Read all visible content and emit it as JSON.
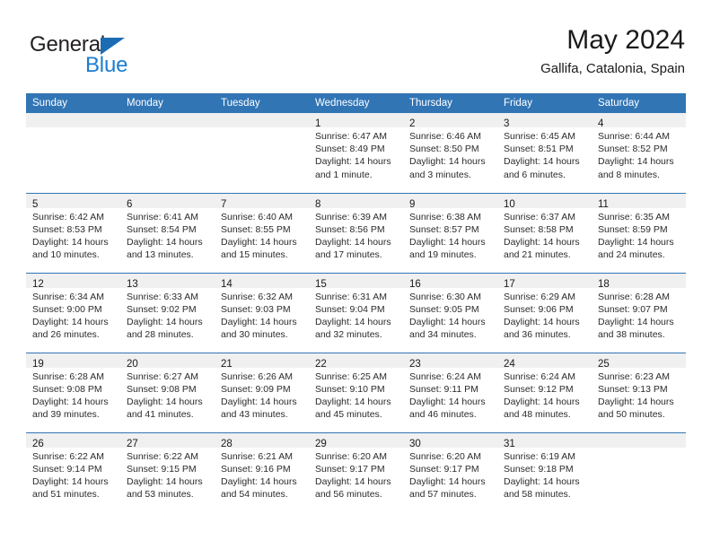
{
  "logo": {
    "word_top": "General",
    "word_bottom": "Blue",
    "triangle_color": "#1b6cb3",
    "blue_color": "#1b7dd1"
  },
  "header": {
    "title": "May 2024",
    "subtitle": "Gallifa, Catalonia, Spain",
    "header_bg": "#3175b5",
    "daynum_bg": "#f0f0f0"
  },
  "weekdays": [
    "Sunday",
    "Monday",
    "Tuesday",
    "Wednesday",
    "Thursday",
    "Friday",
    "Saturday"
  ],
  "labels": {
    "sunrise": "Sunrise:",
    "sunset": "Sunset:",
    "daylight": "Daylight:"
  },
  "weeks": [
    [
      {
        "blank": true
      },
      {
        "blank": true
      },
      {
        "blank": true
      },
      {
        "day": "1",
        "sunrise": "Sunrise: 6:47 AM",
        "sunset": "Sunset: 8:49 PM",
        "daylight_1": "Daylight: 14 hours",
        "daylight_2": "and 1 minute."
      },
      {
        "day": "2",
        "sunrise": "Sunrise: 6:46 AM",
        "sunset": "Sunset: 8:50 PM",
        "daylight_1": "Daylight: 14 hours",
        "daylight_2": "and 3 minutes."
      },
      {
        "day": "3",
        "sunrise": "Sunrise: 6:45 AM",
        "sunset": "Sunset: 8:51 PM",
        "daylight_1": "Daylight: 14 hours",
        "daylight_2": "and 6 minutes."
      },
      {
        "day": "4",
        "sunrise": "Sunrise: 6:44 AM",
        "sunset": "Sunset: 8:52 PM",
        "daylight_1": "Daylight: 14 hours",
        "daylight_2": "and 8 minutes."
      }
    ],
    [
      {
        "day": "5",
        "sunrise": "Sunrise: 6:42 AM",
        "sunset": "Sunset: 8:53 PM",
        "daylight_1": "Daylight: 14 hours",
        "daylight_2": "and 10 minutes."
      },
      {
        "day": "6",
        "sunrise": "Sunrise: 6:41 AM",
        "sunset": "Sunset: 8:54 PM",
        "daylight_1": "Daylight: 14 hours",
        "daylight_2": "and 13 minutes."
      },
      {
        "day": "7",
        "sunrise": "Sunrise: 6:40 AM",
        "sunset": "Sunset: 8:55 PM",
        "daylight_1": "Daylight: 14 hours",
        "daylight_2": "and 15 minutes."
      },
      {
        "day": "8",
        "sunrise": "Sunrise: 6:39 AM",
        "sunset": "Sunset: 8:56 PM",
        "daylight_1": "Daylight: 14 hours",
        "daylight_2": "and 17 minutes."
      },
      {
        "day": "9",
        "sunrise": "Sunrise: 6:38 AM",
        "sunset": "Sunset: 8:57 PM",
        "daylight_1": "Daylight: 14 hours",
        "daylight_2": "and 19 minutes."
      },
      {
        "day": "10",
        "sunrise": "Sunrise: 6:37 AM",
        "sunset": "Sunset: 8:58 PM",
        "daylight_1": "Daylight: 14 hours",
        "daylight_2": "and 21 minutes."
      },
      {
        "day": "11",
        "sunrise": "Sunrise: 6:35 AM",
        "sunset": "Sunset: 8:59 PM",
        "daylight_1": "Daylight: 14 hours",
        "daylight_2": "and 24 minutes."
      }
    ],
    [
      {
        "day": "12",
        "sunrise": "Sunrise: 6:34 AM",
        "sunset": "Sunset: 9:00 PM",
        "daylight_1": "Daylight: 14 hours",
        "daylight_2": "and 26 minutes."
      },
      {
        "day": "13",
        "sunrise": "Sunrise: 6:33 AM",
        "sunset": "Sunset: 9:02 PM",
        "daylight_1": "Daylight: 14 hours",
        "daylight_2": "and 28 minutes."
      },
      {
        "day": "14",
        "sunrise": "Sunrise: 6:32 AM",
        "sunset": "Sunset: 9:03 PM",
        "daylight_1": "Daylight: 14 hours",
        "daylight_2": "and 30 minutes."
      },
      {
        "day": "15",
        "sunrise": "Sunrise: 6:31 AM",
        "sunset": "Sunset: 9:04 PM",
        "daylight_1": "Daylight: 14 hours",
        "daylight_2": "and 32 minutes."
      },
      {
        "day": "16",
        "sunrise": "Sunrise: 6:30 AM",
        "sunset": "Sunset: 9:05 PM",
        "daylight_1": "Daylight: 14 hours",
        "daylight_2": "and 34 minutes."
      },
      {
        "day": "17",
        "sunrise": "Sunrise: 6:29 AM",
        "sunset": "Sunset: 9:06 PM",
        "daylight_1": "Daylight: 14 hours",
        "daylight_2": "and 36 minutes."
      },
      {
        "day": "18",
        "sunrise": "Sunrise: 6:28 AM",
        "sunset": "Sunset: 9:07 PM",
        "daylight_1": "Daylight: 14 hours",
        "daylight_2": "and 38 minutes."
      }
    ],
    [
      {
        "day": "19",
        "sunrise": "Sunrise: 6:28 AM",
        "sunset": "Sunset: 9:08 PM",
        "daylight_1": "Daylight: 14 hours",
        "daylight_2": "and 39 minutes."
      },
      {
        "day": "20",
        "sunrise": "Sunrise: 6:27 AM",
        "sunset": "Sunset: 9:08 PM",
        "daylight_1": "Daylight: 14 hours",
        "daylight_2": "and 41 minutes."
      },
      {
        "day": "21",
        "sunrise": "Sunrise: 6:26 AM",
        "sunset": "Sunset: 9:09 PM",
        "daylight_1": "Daylight: 14 hours",
        "daylight_2": "and 43 minutes."
      },
      {
        "day": "22",
        "sunrise": "Sunrise: 6:25 AM",
        "sunset": "Sunset: 9:10 PM",
        "daylight_1": "Daylight: 14 hours",
        "daylight_2": "and 45 minutes."
      },
      {
        "day": "23",
        "sunrise": "Sunrise: 6:24 AM",
        "sunset": "Sunset: 9:11 PM",
        "daylight_1": "Daylight: 14 hours",
        "daylight_2": "and 46 minutes."
      },
      {
        "day": "24",
        "sunrise": "Sunrise: 6:24 AM",
        "sunset": "Sunset: 9:12 PM",
        "daylight_1": "Daylight: 14 hours",
        "daylight_2": "and 48 minutes."
      },
      {
        "day": "25",
        "sunrise": "Sunrise: 6:23 AM",
        "sunset": "Sunset: 9:13 PM",
        "daylight_1": "Daylight: 14 hours",
        "daylight_2": "and 50 minutes."
      }
    ],
    [
      {
        "day": "26",
        "sunrise": "Sunrise: 6:22 AM",
        "sunset": "Sunset: 9:14 PM",
        "daylight_1": "Daylight: 14 hours",
        "daylight_2": "and 51 minutes."
      },
      {
        "day": "27",
        "sunrise": "Sunrise: 6:22 AM",
        "sunset": "Sunset: 9:15 PM",
        "daylight_1": "Daylight: 14 hours",
        "daylight_2": "and 53 minutes."
      },
      {
        "day": "28",
        "sunrise": "Sunrise: 6:21 AM",
        "sunset": "Sunset: 9:16 PM",
        "daylight_1": "Daylight: 14 hours",
        "daylight_2": "and 54 minutes."
      },
      {
        "day": "29",
        "sunrise": "Sunrise: 6:20 AM",
        "sunset": "Sunset: 9:17 PM",
        "daylight_1": "Daylight: 14 hours",
        "daylight_2": "and 56 minutes."
      },
      {
        "day": "30",
        "sunrise": "Sunrise: 6:20 AM",
        "sunset": "Sunset: 9:17 PM",
        "daylight_1": "Daylight: 14 hours",
        "daylight_2": "and 57 minutes."
      },
      {
        "day": "31",
        "sunrise": "Sunrise: 6:19 AM",
        "sunset": "Sunset: 9:18 PM",
        "daylight_1": "Daylight: 14 hours",
        "daylight_2": "and 58 minutes."
      },
      {
        "blank": true
      }
    ]
  ]
}
